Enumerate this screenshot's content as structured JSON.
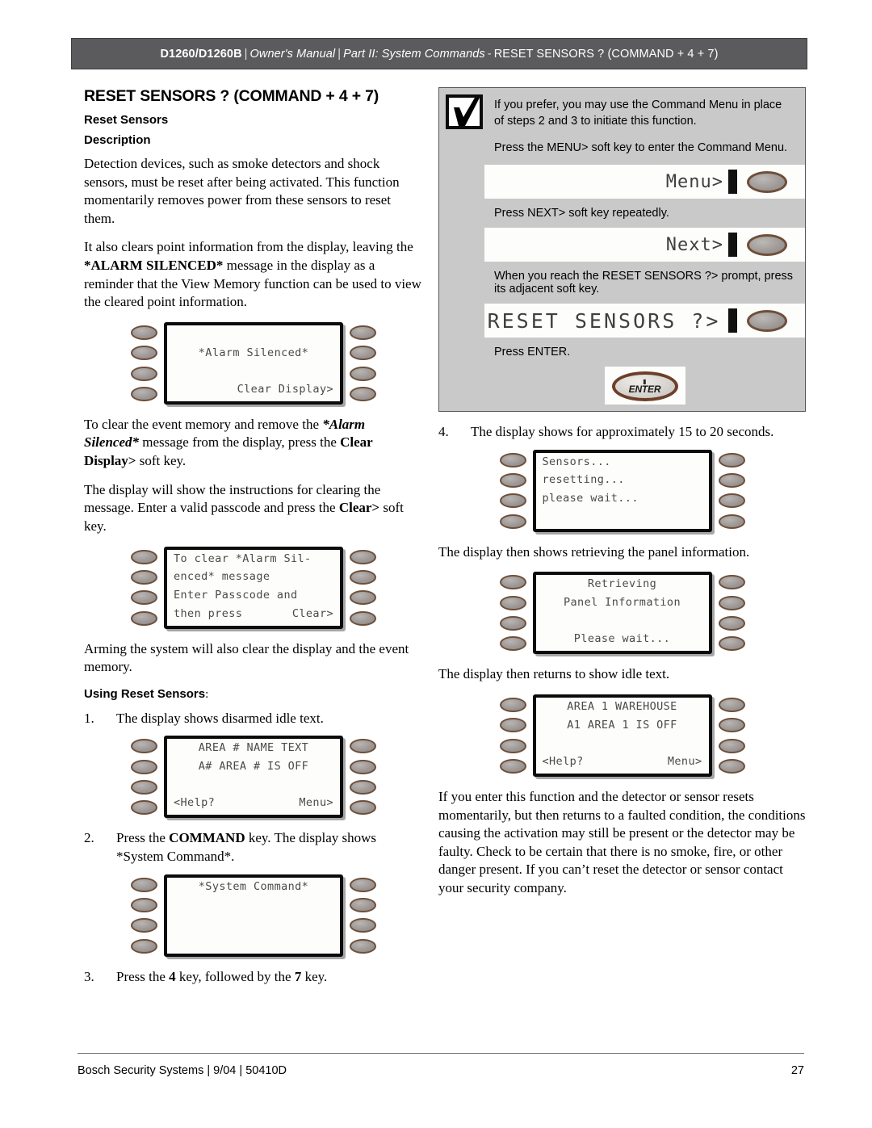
{
  "header": {
    "product": "D1260/D1260B",
    "manual": "Owner's Manual",
    "part": "Part II: System Commands",
    "topic": "RESET SENSORS ? (COMMAND + 4 + 7)",
    "separator": "|",
    "dash": "-"
  },
  "left": {
    "section_title": "RESET SENSORS ? (COMMAND + 4 + 7)",
    "sub_head": "Reset Sensors",
    "sub_head2": "Description",
    "para1": "Detection devices, such as smoke detectors and shock sensors, must be reset after being activated. This function momentarily removes power from these sensors to reset them.",
    "para2_a": "It also clears point information from the display, leaving the ",
    "para2_b": "*ALARM SILENCED*",
    "para2_c": " message in the display as a reminder that the View Memory function can be used to view the cleared point information.",
    "display1": {
      "line1": "",
      "line2": "*Alarm Silenced*",
      "line3": "",
      "line4": "Clear Display>"
    },
    "para3_a": "To clear the event memory and remove the ",
    "para3_b": "*Alarm Silenced*",
    "para3_c": " message from the display, press the ",
    "para3_d": "Clear Display>",
    "para3_e": " soft key.",
    "para4_a": "The display will show the instructions for clearing the message. Enter a valid passcode and press the ",
    "para4_b": "Clear>",
    "para4_c": " soft key.",
    "display2": {
      "line1": "To clear *Alarm Sil-",
      "line2": "enced* message",
      "line3": "Enter Passcode and",
      "line4_left": "then press",
      "line4_right": "Clear>"
    },
    "para5": "Arming the system will also clear the display and the event memory.",
    "using_head": "Using Reset Sensors",
    "using_colon": ":",
    "step1_num": "1.",
    "step1_text": "The display shows disarmed idle text.",
    "display3": {
      "line1": "AREA # NAME TEXT",
      "line2": "A# AREA # IS OFF",
      "line3": "",
      "line4_left": "<Help?",
      "line4_right": "Menu>"
    },
    "step2_num": "2.",
    "step2_a": "Press the ",
    "step2_b": "COMMAND",
    "step2_c": " key. The display shows ",
    "step2_d": "*System Command*",
    "step2_e": ".",
    "display4": {
      "line1": "*System Command*",
      "line2": "",
      "line3": "",
      "line4": ""
    },
    "step3_num": "3.",
    "step3_a": "Press the ",
    "step3_b": "4",
    "step3_c": " key, followed by the ",
    "step3_d": "7",
    "step3_e": " key."
  },
  "note": {
    "icon": "checkbox-checked-icon",
    "para1": "If you prefer, you may use the Command Menu in place of steps 2 and 3 to initiate this function.",
    "para2": "Press the MENU> soft key to enter the Command Menu.",
    "strip1_text": "Menu>",
    "caption1": "Press NEXT> soft key repeatedly.",
    "strip2_text": "Next>",
    "caption2": "When you reach the RESET SENSORS ?> prompt, press its adjacent soft key.",
    "strip3_text": "RESET SENSORS ?>",
    "caption3": "Press ENTER.",
    "enter_label": "ENTER"
  },
  "right": {
    "step4_num": "4.",
    "step4_text": "The display shows for approximately 15 to 20 seconds.",
    "display5": {
      "line1": "Sensors...",
      "line2": "resetting...",
      "line3": "please wait...",
      "line4": ""
    },
    "para1": "The display then shows retrieving the panel information.",
    "display6": {
      "line1": "Retrieving",
      "line2": "Panel Information",
      "line3": "",
      "line4": "Please wait..."
    },
    "para2": "The display then returns to show idle text.",
    "display7": {
      "line1": "AREA 1 WAREHOUSE",
      "line2": "A1 AREA 1 IS OFF",
      "line3": "",
      "line4_left": "<Help?",
      "line4_right": "Menu>"
    },
    "para3": "If you enter this function and the detector or sensor resets momentarily, but then returns to a faulted condition, the conditions causing the activation may still be present or the detector may be faulty. Check to be certain that there is no smoke, fire, or other danger present. If you can’t reset the detector or sensor contact your security company."
  },
  "footer": {
    "left": "Bosch Security Systems | 9/04 | 50410D",
    "page_number": "27"
  },
  "colors": {
    "header_bar": "#5b5b5d",
    "note_bg": "#c9c9c9",
    "lcd_bg": "#fdfdfb",
    "button_ring": "#6e4f3a"
  }
}
